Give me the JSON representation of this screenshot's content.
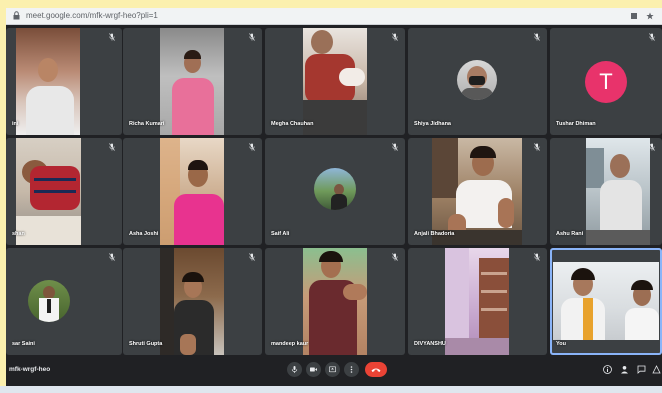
{
  "browser": {
    "url": "meet.google.com/mfk-wrgf-heo?pli=1"
  },
  "participants": [
    {
      "name": "ini"
    },
    {
      "name": "Richa Kumari"
    },
    {
      "name": "Megha Chauhan"
    },
    {
      "name": "Shiya Jidhana"
    },
    {
      "name": "Tushar Dhiman",
      "avatar_letter": "T"
    },
    {
      "name": "shan"
    },
    {
      "name": "Asha Joshi"
    },
    {
      "name": "Saif Ali"
    },
    {
      "name": "Anjali Bhadoria"
    },
    {
      "name": "Ashu Rani"
    },
    {
      "name": "sar Saini"
    },
    {
      "name": "Shruti Gupta"
    },
    {
      "name": "mandeep kaur"
    },
    {
      "name": "DIVYANSHU"
    },
    {
      "name": "You"
    }
  ],
  "meeting": {
    "code": "mfk-wrgf-heo"
  },
  "colors": {
    "background": "#202124",
    "tile": "#3c4043",
    "end_call": "#ea4335",
    "avatar": "#e8336b",
    "speaking_border": "#8ab4f8"
  },
  "icons": {
    "mic_muted": "mic-off-icon",
    "controls": [
      "mic-icon",
      "camera-icon",
      "present-icon",
      "more-icon",
      "end-call-icon"
    ],
    "right": [
      "info-icon",
      "people-icon",
      "chat-icon",
      "activities-icon"
    ]
  }
}
